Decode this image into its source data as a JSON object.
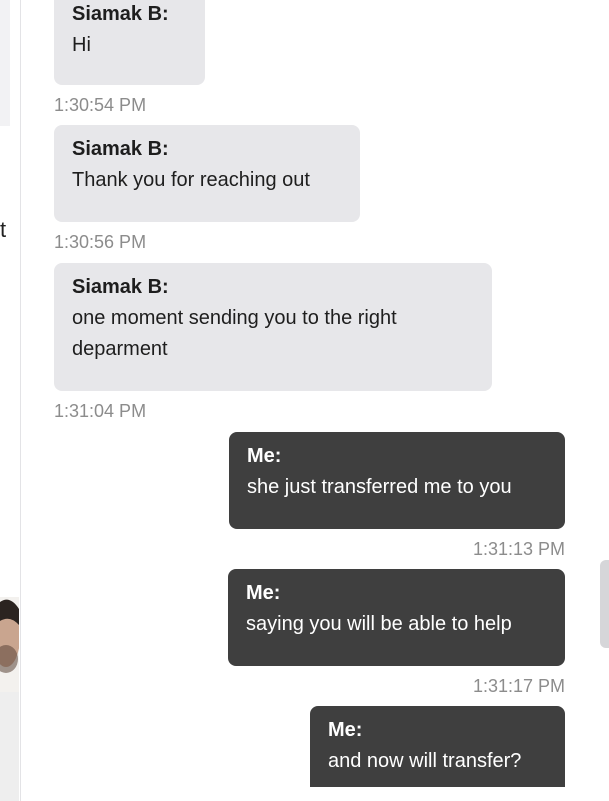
{
  "left_panel": {
    "partial_text": "t"
  },
  "messages": [
    {
      "sender": "Siamak B:",
      "text": "Hi",
      "time": "1:30:54 PM"
    },
    {
      "sender": "Siamak B:",
      "text": "Thank you for reaching out",
      "time": "1:30:56 PM"
    },
    {
      "sender": "Siamak B:",
      "text": "one moment sending you to the right deparment",
      "time": "1:31:04 PM"
    },
    {
      "sender": "Me:",
      "text": "she just transferred me to you",
      "time": "1:31:13 PM"
    },
    {
      "sender": "Me:",
      "text": "saying you will be able to help",
      "time": "1:31:17 PM"
    },
    {
      "sender": "Me:",
      "text": "and now will transfer?",
      "time": ""
    }
  ],
  "colors": {
    "incoming_bubble": "#e7e7ea",
    "outgoing_bubble": "#3f3f3f",
    "timestamp": "#8c8c8c"
  }
}
